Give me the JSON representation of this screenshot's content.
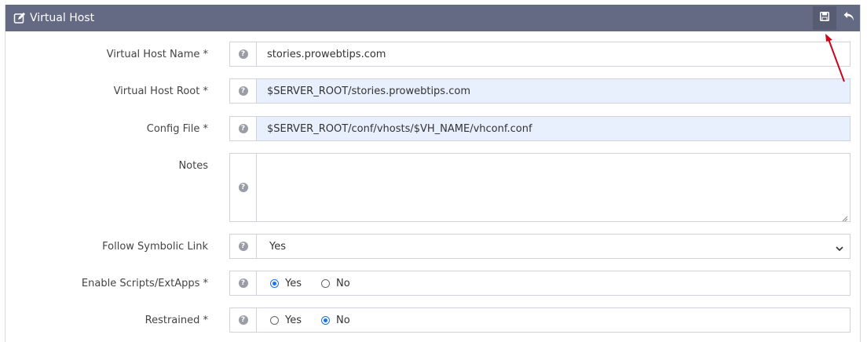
{
  "header": {
    "title": "Virtual Host",
    "title_icon": "edit-icon",
    "save_icon": "save-icon",
    "undo_icon": "undo-icon",
    "bg_color": "#646a83"
  },
  "fields": {
    "vh_name": {
      "label": "Virtual Host Name *",
      "value": "stories.prowebtips.com"
    },
    "vh_root": {
      "label": "Virtual Host Root *",
      "value": "$SERVER_ROOT/stories.prowebtips.com"
    },
    "config_file": {
      "label": "Config File *",
      "value": "$SERVER_ROOT/conf/vhosts/$VH_NAME/vhconf.conf"
    },
    "notes": {
      "label": "Notes",
      "value": ""
    },
    "follow_symlink": {
      "label": "Follow Symbolic Link",
      "selected": "Yes"
    },
    "enable_scripts": {
      "label": "Enable Scripts/ExtApps *",
      "yes": "Yes",
      "no": "No",
      "selected": "Yes"
    },
    "restrained": {
      "label": "Restrained *",
      "yes": "Yes",
      "no": "No",
      "selected": "No"
    }
  },
  "help_glyph": "?",
  "colors": {
    "accent": "#1a73e8",
    "autofill": "#e8f0fe",
    "annotation": "#d0021b"
  }
}
